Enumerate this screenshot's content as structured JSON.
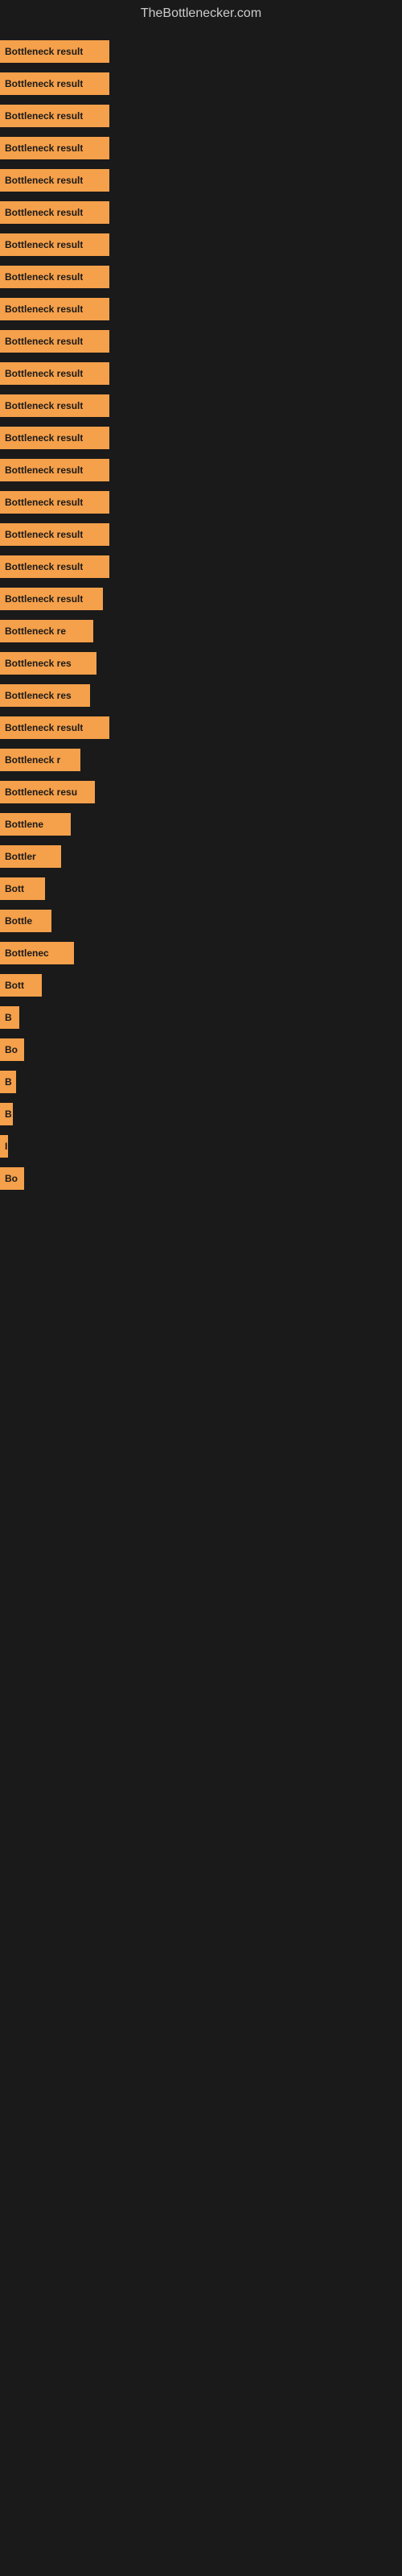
{
  "site": {
    "title": "TheBottlenecker.com"
  },
  "bars": [
    {
      "label": "Bottleneck result",
      "width": 136
    },
    {
      "label": "Bottleneck result",
      "width": 136
    },
    {
      "label": "Bottleneck result",
      "width": 136
    },
    {
      "label": "Bottleneck result",
      "width": 136
    },
    {
      "label": "Bottleneck result",
      "width": 136
    },
    {
      "label": "Bottleneck result",
      "width": 136
    },
    {
      "label": "Bottleneck result",
      "width": 136
    },
    {
      "label": "Bottleneck result",
      "width": 136
    },
    {
      "label": "Bottleneck result",
      "width": 136
    },
    {
      "label": "Bottleneck result",
      "width": 136
    },
    {
      "label": "Bottleneck result",
      "width": 136
    },
    {
      "label": "Bottleneck result",
      "width": 136
    },
    {
      "label": "Bottleneck result",
      "width": 136
    },
    {
      "label": "Bottleneck result",
      "width": 136
    },
    {
      "label": "Bottleneck result",
      "width": 136
    },
    {
      "label": "Bottleneck result",
      "width": 136
    },
    {
      "label": "Bottleneck result",
      "width": 136
    },
    {
      "label": "Bottleneck result",
      "width": 128
    },
    {
      "label": "Bottleneck re",
      "width": 116
    },
    {
      "label": "Bottleneck res",
      "width": 120
    },
    {
      "label": "Bottleneck res",
      "width": 112
    },
    {
      "label": "Bottleneck result",
      "width": 136
    },
    {
      "label": "Bottleneck r",
      "width": 100
    },
    {
      "label": "Bottleneck resu",
      "width": 118
    },
    {
      "label": "Bottlene",
      "width": 88
    },
    {
      "label": "Bottler",
      "width": 76
    },
    {
      "label": "Bott",
      "width": 56
    },
    {
      "label": "Bottle",
      "width": 64
    },
    {
      "label": "Bottlenec",
      "width": 92
    },
    {
      "label": "Bott",
      "width": 52
    },
    {
      "label": "B",
      "width": 24
    },
    {
      "label": "Bo",
      "width": 30
    },
    {
      "label": "B",
      "width": 20
    },
    {
      "label": "B",
      "width": 16
    },
    {
      "label": "I",
      "width": 10
    },
    {
      "label": "Bo",
      "width": 30
    }
  ],
  "colors": {
    "bar_fill": "#f5a04a",
    "background": "#1a1a1a",
    "title_color": "#cccccc",
    "label_color": "#1a1a1a"
  }
}
